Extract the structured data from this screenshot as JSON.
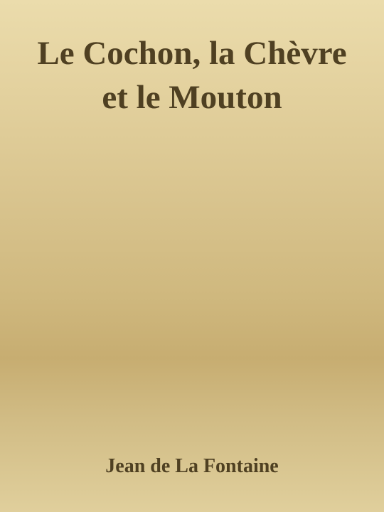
{
  "cover": {
    "title": "Le Cochon, la Chèvre et le Mouton",
    "author": "Jean de La Fontaine"
  }
}
